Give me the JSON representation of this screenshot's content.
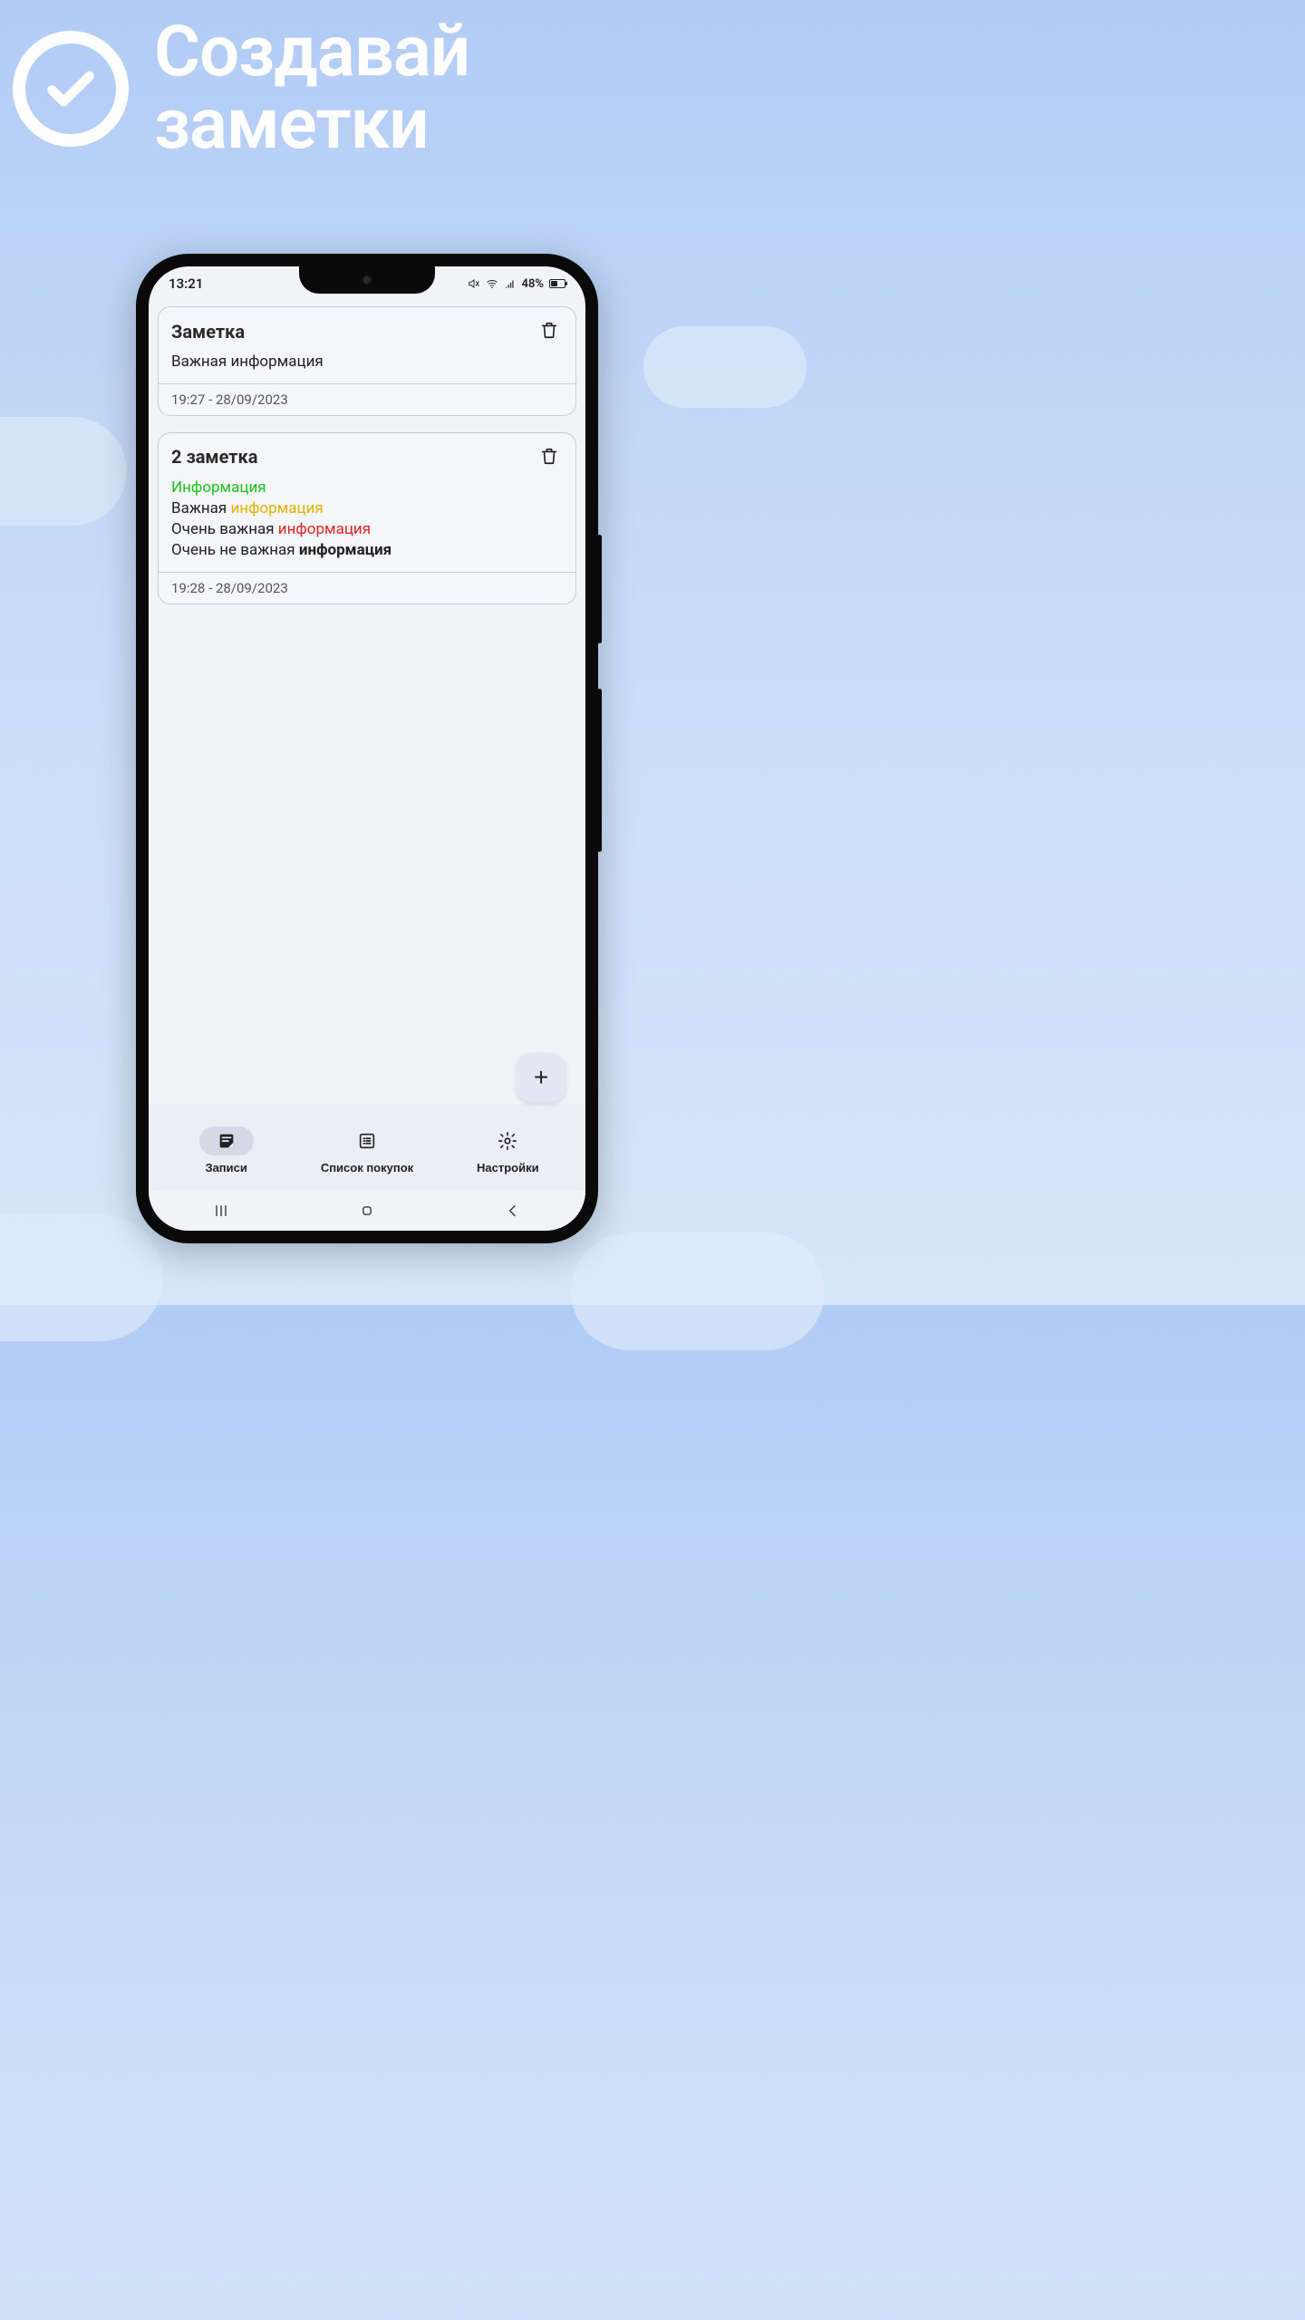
{
  "hero": {
    "line1": "Создавай",
    "line2": "заметки"
  },
  "statusbar": {
    "time": "13:21",
    "battery_text": "48%"
  },
  "notes": [
    {
      "title": "Заметка",
      "timestamp": "19:27 - 28/09/2023",
      "body_plain": "Важная информация"
    },
    {
      "title": "2 заметка",
      "timestamp": "19:28 - 28/09/2023",
      "lines": {
        "l1": "Информация",
        "l2a": "Важная ",
        "l2b": "информация",
        "l3a": "Очень важная ",
        "l3b": "информация",
        "l4a": "Очень не важная ",
        "l4b": "информация"
      }
    }
  ],
  "fab": {
    "label": "+"
  },
  "bottomnav": {
    "notes": "Записи",
    "shopping": "Список покупок",
    "settings": "Настройки"
  }
}
